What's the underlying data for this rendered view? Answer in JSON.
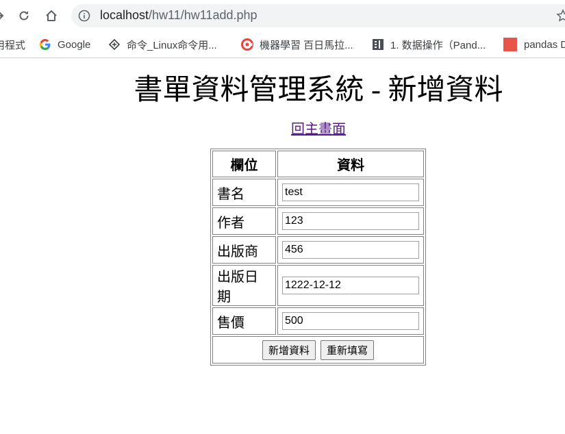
{
  "browser": {
    "url_host": "localhost",
    "url_path": "/hw11/hw11add.php"
  },
  "bookmarks": [
    {
      "label": "用程式",
      "icon": "apps-icon"
    },
    {
      "label": "Google",
      "icon": "google-icon"
    },
    {
      "label": "命令_Linux命令用...",
      "icon": "command-icon"
    },
    {
      "label": "機器學習 百日馬拉...",
      "icon": "cupoy-icon"
    },
    {
      "label": "1. 数据操作（Pand...",
      "icon": "book-icon"
    },
    {
      "label": "pandas D",
      "icon": "pandas-icon"
    }
  ],
  "page": {
    "title": "書單資料管理系統 - 新增資料",
    "back_link": "回主畫面"
  },
  "form": {
    "header_field": "欄位",
    "header_data": "資料",
    "rows": [
      {
        "label": "書名",
        "value": "test"
      },
      {
        "label": "作者",
        "value": "123"
      },
      {
        "label": "出版商",
        "value": "456"
      },
      {
        "label": "出版日期",
        "value": "1222-12-12"
      },
      {
        "label": "售價",
        "value": "500"
      }
    ],
    "submit_label": "新增資料",
    "reset_label": "重新填寫"
  },
  "colors": {
    "link_visited": "#551a8b",
    "omnibox_bg": "#f1f3f4",
    "pandas_icon": "#e8534a"
  }
}
